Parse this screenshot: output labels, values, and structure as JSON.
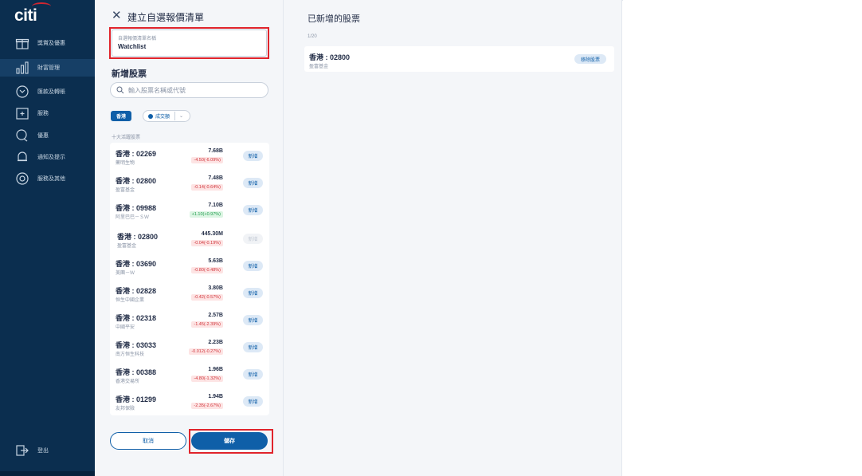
{
  "brand": {
    "logo": "citi",
    "accent": "#d22630",
    "sidebar_bg": "#0b2e4f",
    "primary": "#0f5fa8"
  },
  "sidebar": {
    "items": [
      {
        "icon": "gift-icon",
        "label": "獎賞及優惠",
        "active": false
      },
      {
        "icon": "chart-icon",
        "label": "財富管理",
        "active": true
      },
      {
        "icon": "currency-icon",
        "label": "匯款及轉賬",
        "active": false
      },
      {
        "icon": "calendar-icon",
        "label": "服務",
        "active": false
      },
      {
        "icon": "chat-icon",
        "label": "優惠",
        "active": false
      },
      {
        "icon": "bell-icon",
        "label": "通知及提示",
        "active": false
      },
      {
        "icon": "help-icon",
        "label": "服務及其他",
        "active": false
      }
    ],
    "logout": {
      "icon": "logout-icon",
      "label": "登出"
    }
  },
  "form": {
    "close_icon": "close-icon",
    "title": "建立自選報價清單",
    "name_field_label": "自選報價清單名稱",
    "name_field_value": "Watchlist",
    "section_title": "新增股票",
    "search_placeholder": "輸入股票名稱或代號",
    "market_tab": "香港",
    "sort_label": "成交額",
    "list_caption": "十大活躍股票",
    "cancel_label": "取消",
    "save_label": "儲存"
  },
  "stocks": [
    {
      "code": "香港 : 02269",
      "name": "藥明生物",
      "volume": "7.68B",
      "change": "-4.50(-6.09%)",
      "dir": "down",
      "add": "新增",
      "disabled": false
    },
    {
      "code": "香港 : 02800",
      "name": "盈富基金",
      "volume": "7.48B",
      "change": "-0.14(-0.64%)",
      "dir": "down",
      "add": "新增",
      "disabled": false
    },
    {
      "code": "香港 : 09988",
      "name": "阿里巴巴－ＳＷ",
      "volume": "7.10B",
      "change": "+1.10(+0.97%)",
      "dir": "up",
      "add": "新增",
      "disabled": false
    },
    {
      "code": "香港 : 02800",
      "name": "盈富基金",
      "volume": "445.30M",
      "change": "-0.04(-0.19%)",
      "dir": "down",
      "add": "新增",
      "disabled": true
    },
    {
      "code": "香港 : 03690",
      "name": "美團－Ｗ",
      "volume": "5.63B",
      "change": "-0.80(-0.48%)",
      "dir": "down",
      "add": "新增",
      "disabled": false
    },
    {
      "code": "香港 : 02828",
      "name": "恒生中國企業",
      "volume": "3.80B",
      "change": "-0.42(-0.57%)",
      "dir": "down",
      "add": "新增",
      "disabled": false
    },
    {
      "code": "香港 : 02318",
      "name": "中國平安",
      "volume": "2.57B",
      "change": "-1.45(-2.39%)",
      "dir": "down",
      "add": "新增",
      "disabled": false
    },
    {
      "code": "香港 : 03033",
      "name": "南方恒生科技",
      "volume": "2.23B",
      "change": "-0.012(-0.27%)",
      "dir": "down",
      "add": "新增",
      "disabled": false
    },
    {
      "code": "香港 : 00388",
      "name": "香港交易所",
      "volume": "1.96B",
      "change": "-4.80(-1.32%)",
      "dir": "down",
      "add": "新增",
      "disabled": false
    },
    {
      "code": "香港 : 01299",
      "name": "友邦保險",
      "volume": "1.94B",
      "change": "-2.35(-2.67%)",
      "dir": "down",
      "add": "新增",
      "disabled": false
    }
  ],
  "added": {
    "title": "已新增的股票",
    "count": "1/20",
    "items": [
      {
        "code": "香港 : 02800",
        "name": "盈富基金",
        "remove": "移除股票"
      }
    ]
  }
}
